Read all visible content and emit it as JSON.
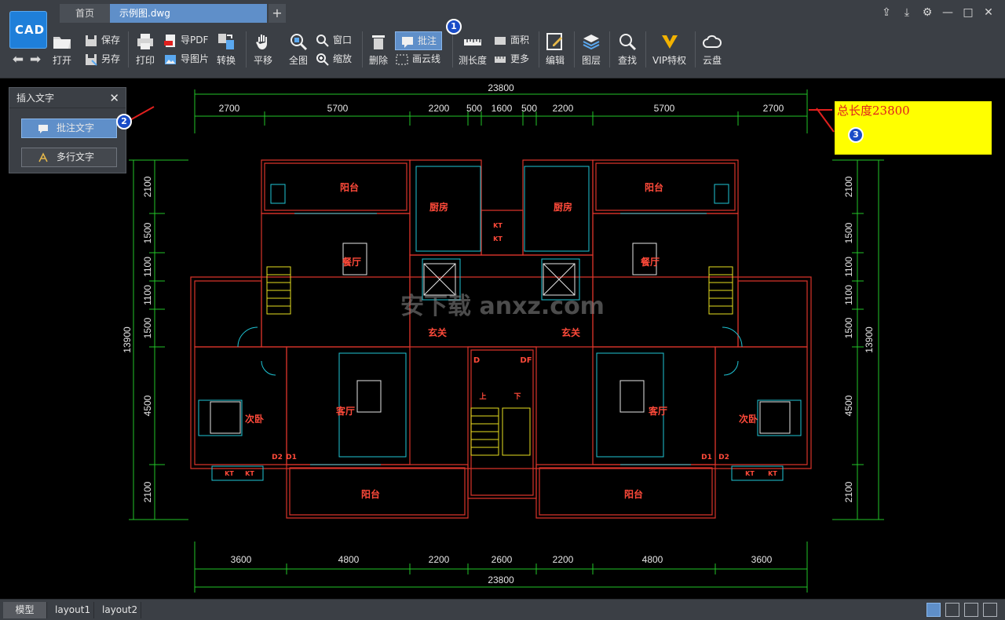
{
  "app": {
    "logo_text": "CAD"
  },
  "tabs": {
    "home": "首页",
    "file": "示例图.dwg",
    "add": "+"
  },
  "window_controls": [
    "share-icon",
    "download-icon",
    "settings-icon",
    "minimize-icon",
    "maximize-icon",
    "close-icon"
  ],
  "toolbar": {
    "open": "打开",
    "save": "保存",
    "save_as": "另存",
    "print": "打印",
    "export_pdf": "导PDF",
    "export_img": "导图片",
    "convert": "转换",
    "pan": "平移",
    "fit_all": "全图",
    "window": "窗口",
    "zoom": "缩放",
    "delete": "删除",
    "annotate": "批注",
    "cloud_line": "画云线",
    "measure_length": "测长度",
    "area": "面积",
    "more": "更多",
    "edit": "编辑",
    "layers": "图层",
    "find": "查找",
    "vip": "VIP特权",
    "cloud": "云盘"
  },
  "insert_text_panel": {
    "title": "插入文字",
    "close": "✕",
    "annotation_text": "批注文字",
    "multiline_text": "多行文字"
  },
  "annotation_box": {
    "text": "总长度23800"
  },
  "badges": [
    "1",
    "2",
    "3"
  ],
  "drawing": {
    "top_total": "23800",
    "top_segments": [
      "2700",
      "5700",
      "2200",
      "500",
      "1600",
      "500",
      "2200",
      "5700",
      "2700"
    ],
    "bottom_segments": [
      "3600",
      "4800",
      "2200",
      "2600",
      "2200",
      "4800",
      "3600"
    ],
    "bottom_total": "23800",
    "left_total": "13900",
    "right_total": "13900",
    "vertical_segments": [
      "2100",
      "1500",
      "1100",
      "1100",
      "1500",
      "4500",
      "2100"
    ],
    "rooms": {
      "balcony": "阳台",
      "kitchen": "厨房",
      "dining": "餐厅",
      "entrance": "玄关",
      "living": "客厅",
      "bedroom": "次卧",
      "up": "上",
      "down": "下",
      "d": "D",
      "df": "DF",
      "d1": "D1",
      "d2": "D2",
      "kt": "KT"
    },
    "watermark": "安下载 anxz.com"
  },
  "status": {
    "tabs": [
      "模型",
      "layout1",
      "layout2"
    ],
    "icons": [
      "crosshair-icon",
      "hatch-icon",
      "blocks-icon",
      "view-icon"
    ]
  }
}
